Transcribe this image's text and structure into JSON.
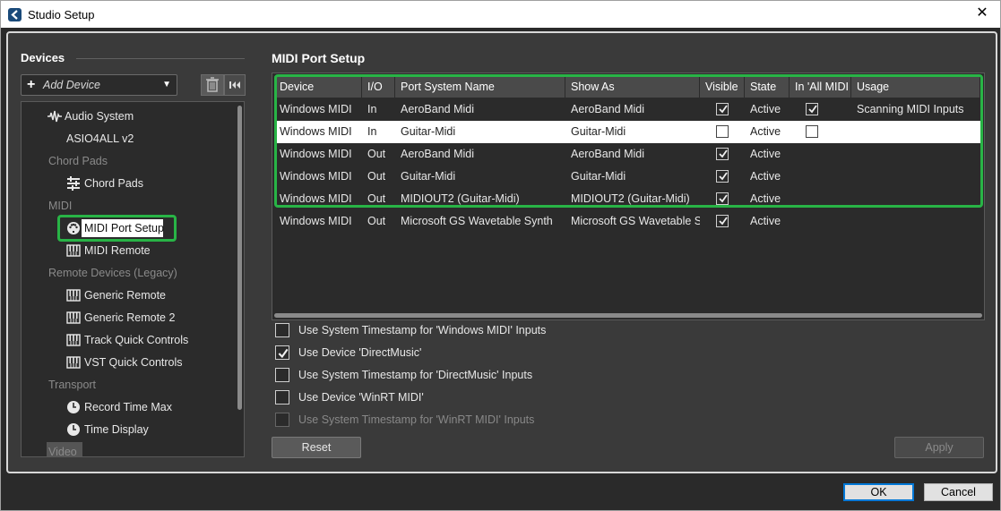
{
  "window": {
    "title": "Studio Setup"
  },
  "devices": {
    "title": "Devices",
    "add_device_label": "Add Device",
    "tree": [
      {
        "kind": "item",
        "label": "Audio System",
        "icon": "waveform-icon",
        "indent": 1
      },
      {
        "kind": "item",
        "label": "ASIO4ALL v2",
        "icon": "",
        "indent": 2
      },
      {
        "kind": "category",
        "label": "Chord Pads"
      },
      {
        "kind": "item",
        "label": "Chord Pads",
        "icon": "chord-pads-icon",
        "indent": 2
      },
      {
        "kind": "category",
        "label": "MIDI"
      },
      {
        "kind": "item",
        "label": "MIDI Port Setup",
        "icon": "midi-port-icon",
        "indent": 2,
        "selected": true
      },
      {
        "kind": "item",
        "label": "MIDI Remote",
        "icon": "keyboard-icon",
        "indent": 2
      },
      {
        "kind": "category",
        "label": "Remote Devices (Legacy)"
      },
      {
        "kind": "item",
        "label": "Generic Remote",
        "icon": "keyboard-icon",
        "indent": 2
      },
      {
        "kind": "item",
        "label": "Generic Remote 2",
        "icon": "keyboard-icon",
        "indent": 2
      },
      {
        "kind": "item",
        "label": "Track Quick Controls",
        "icon": "keyboard-icon",
        "indent": 2
      },
      {
        "kind": "item",
        "label": "VST Quick Controls",
        "icon": "keyboard-icon",
        "indent": 2
      },
      {
        "kind": "category",
        "label": "Transport"
      },
      {
        "kind": "item",
        "label": "Record Time Max",
        "icon": "clock-icon",
        "indent": 2
      },
      {
        "kind": "item",
        "label": "Time Display",
        "icon": "clock-icon",
        "indent": 2
      },
      {
        "kind": "category",
        "label": "Video"
      }
    ]
  },
  "midi_port_setup": {
    "title": "MIDI Port Setup",
    "columns": [
      "Device",
      "I/O",
      "Port System Name",
      "Show As",
      "Visible",
      "State",
      "In 'All MIDI Inputs'",
      "Usage"
    ],
    "rows": [
      {
        "device": "Windows MIDI",
        "io": "In",
        "port": "AeroBand Midi",
        "show_as": "AeroBand Midi",
        "visible": true,
        "state": "Active",
        "in_all": true,
        "usage": "Scanning MIDI Inputs"
      },
      {
        "device": "Windows MIDI",
        "io": "In",
        "port": "Guitar-Midi",
        "show_as": "Guitar-Midi",
        "visible": false,
        "state": "Active",
        "in_all": false,
        "usage": ""
      },
      {
        "device": "Windows MIDI",
        "io": "Out",
        "port": "AeroBand Midi",
        "show_as": "AeroBand Midi",
        "visible": true,
        "state": "Active",
        "in_all": null,
        "usage": ""
      },
      {
        "device": "Windows MIDI",
        "io": "Out",
        "port": "Guitar-Midi",
        "show_as": "Guitar-Midi",
        "visible": true,
        "state": "Active",
        "in_all": null,
        "usage": ""
      },
      {
        "device": "Windows MIDI",
        "io": "Out",
        "port": "MIDIOUT2 (Guitar-Midi)",
        "show_as": "MIDIOUT2 (Guitar-Midi)",
        "visible": true,
        "state": "Active",
        "in_all": null,
        "usage": ""
      },
      {
        "device": "Windows MIDI",
        "io": "Out",
        "port": "Microsoft GS Wavetable Synth",
        "show_as": "Microsoft GS Wavetable Synth",
        "visible": true,
        "state": "Active",
        "in_all": null,
        "usage": ""
      }
    ],
    "options": [
      {
        "label": "Use System Timestamp for 'Windows MIDI' Inputs",
        "checked": false,
        "disabled": false
      },
      {
        "label": "Use Device 'DirectMusic'",
        "checked": true,
        "disabled": false
      },
      {
        "label": "Use System Timestamp for 'DirectMusic' Inputs",
        "checked": false,
        "disabled": false
      },
      {
        "label": "Use Device 'WinRT MIDI'",
        "checked": false,
        "disabled": false
      },
      {
        "label": "Use System Timestamp for 'WinRT MIDI' Inputs",
        "checked": false,
        "disabled": true
      }
    ],
    "reset_label": "Reset",
    "apply_label": "Apply"
  },
  "footer": {
    "ok_label": "OK",
    "cancel_label": "Cancel"
  },
  "colors": {
    "highlight": "#28b446",
    "background": "#3a3a3a",
    "panel": "#2b2b2b"
  }
}
